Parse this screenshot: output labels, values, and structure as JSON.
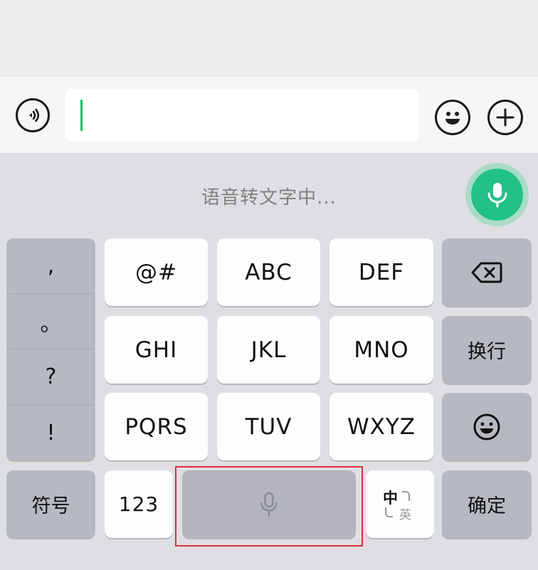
{
  "input_bar": {
    "voice_toggle_icon": "voice-wave-icon",
    "text_value": "",
    "emoji_icon": "emoji-icon",
    "plus_icon": "plus-icon"
  },
  "voice": {
    "status_text": "语音转文字中...",
    "mic_icon": "microphone-icon",
    "accent_color": "#22c187"
  },
  "keyboard": {
    "punctuation": [
      ",",
      "。",
      "?",
      "!"
    ],
    "keys": {
      "symbols": "@#",
      "abc": "ABC",
      "def": "DEF",
      "ghi": "GHI",
      "jkl": "JKL",
      "mno": "MNO",
      "pqrs": "PQRS",
      "tuv": "TUV",
      "wxyz": "WXYZ",
      "newline": "换行",
      "symbol_panel": "符号",
      "numbers": "123",
      "confirm": "确定"
    },
    "backspace_icon": "backspace-icon",
    "emoji_key_icon": "emoji-icon",
    "space_icon": "microphone-icon",
    "lang_switch": {
      "primary": "中",
      "secondary": "英"
    }
  }
}
